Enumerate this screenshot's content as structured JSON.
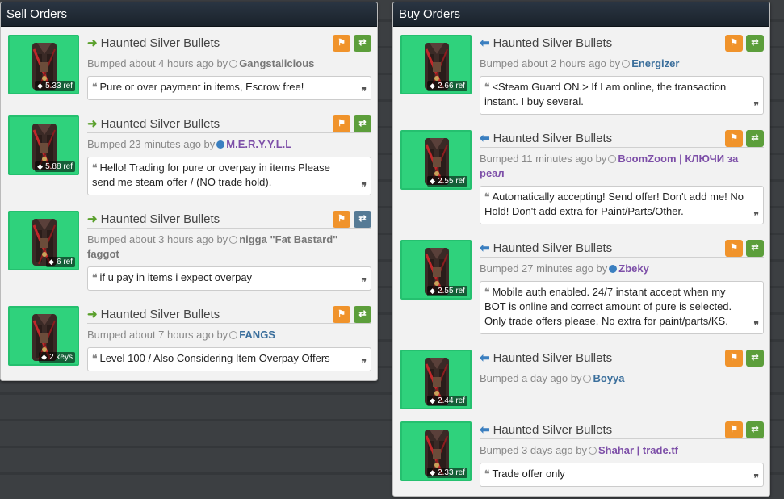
{
  "sell": {
    "title": "Sell Orders",
    "listings": [
      {
        "item": "Haunted Silver Bullets",
        "price": "5.33 ref",
        "bumped": "Bumped about 4 hours ago by",
        "user": "Gangstalicious",
        "user_color": "#777777",
        "online": false,
        "btn_color": "green",
        "message": "Pure or over payment in items, Escrow free!"
      },
      {
        "item": "Haunted Silver Bullets",
        "price": "5.88 ref",
        "bumped": "Bumped 23 minutes ago by",
        "user": "M.E.R.Y.Y.L.L",
        "user_color": "#7d4fa8",
        "online": true,
        "btn_color": "green",
        "message": "Hello! Trading for pure or overpay in items Please send me steam offer / (NO trade hold)."
      },
      {
        "item": "Haunted Silver Bullets",
        "price": "6 ref",
        "bumped": "Bumped about 3 hours ago by",
        "user": "nigga \"Fat Bastard\" faggot",
        "user_color": "#777777",
        "online": false,
        "btn_color": "blue",
        "message": "if u pay in items i expect overpay"
      },
      {
        "item": "Haunted Silver Bullets",
        "price": "2 keys",
        "bumped": "Bumped about 7 hours ago by",
        "user": "FANGS",
        "user_color": "#3b6f9c",
        "online": false,
        "btn_color": "green",
        "message": "Level 100 / Also Considering Item Overpay Offers"
      }
    ]
  },
  "buy": {
    "title": "Buy Orders",
    "listings": [
      {
        "item": "Haunted Silver Bullets",
        "price": "2.66 ref",
        "bumped": "Bumped about 2 hours ago by",
        "user": "Energizer",
        "user_color": "#3b6f9c",
        "online": false,
        "btn_color": "green",
        "message": "<Steam Guard ON.> If I am online, the transaction instant. I buy several."
      },
      {
        "item": "Haunted Silver Bullets",
        "price": "2.55 ref",
        "bumped": "Bumped 11 minutes ago by",
        "user": "BoomZoom | КЛЮЧИ за реал",
        "user_color": "#7d4fa8",
        "online": false,
        "btn_color": "green",
        "message": "Automatically accepting! Send offer! Don't add me! No Hold! Don't add extra for Paint/Parts/Other."
      },
      {
        "item": "Haunted Silver Bullets",
        "price": "2.55 ref",
        "bumped": "Bumped 27 minutes ago by",
        "user": "Zbeky",
        "user_color": "#7d4fa8",
        "online": true,
        "btn_color": "green",
        "message": "Mobile auth enabled. 24/7 instant accept when my BOT is online and correct amount of pure is selected. Only trade offers please. No extra for paint/parts/KS."
      },
      {
        "item": "Haunted Silver Bullets",
        "price": "2.44 ref",
        "bumped": "Bumped a day ago by",
        "user": "Boyya",
        "user_color": "#3b6f9c",
        "online": false,
        "btn_color": "green",
        "message": ""
      },
      {
        "item": "Haunted Silver Bullets",
        "price": "2.33 ref",
        "bumped": "Bumped 3 days ago by",
        "user": "Shahar | trade.tf",
        "user_color": "#7d4fa8",
        "online": false,
        "btn_color": "green",
        "message": "Trade offer only"
      }
    ]
  },
  "icons": {
    "sell_arrow": "arrow-right-icon",
    "buy_arrow": "arrow-left-icon",
    "flag": "flag-icon",
    "swap": "swap-icon",
    "tag": "tag-icon",
    "quote_open": "quote-open-icon",
    "quote_close": "quote-close-icon"
  }
}
